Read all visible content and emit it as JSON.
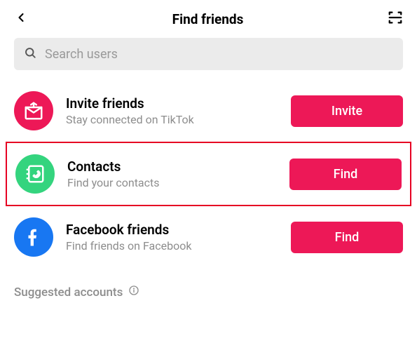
{
  "header": {
    "title": "Find friends"
  },
  "search": {
    "placeholder": "Search users"
  },
  "colors": {
    "accent": "#ed1857",
    "green": "#34d47e",
    "facebook": "#1877f2"
  },
  "rows": [
    {
      "icon": "invite-icon",
      "title": "Invite friends",
      "subtitle": "Stay connected on TikTok",
      "button": "Invite",
      "highlight": false
    },
    {
      "icon": "contacts-icon",
      "title": "Contacts",
      "subtitle": "Find your contacts",
      "button": "Find",
      "highlight": true
    },
    {
      "icon": "facebook-icon",
      "title": "Facebook friends",
      "subtitle": "Find friends on Facebook",
      "button": "Find",
      "highlight": false
    }
  ],
  "suggested": {
    "label": "Suggested accounts"
  }
}
